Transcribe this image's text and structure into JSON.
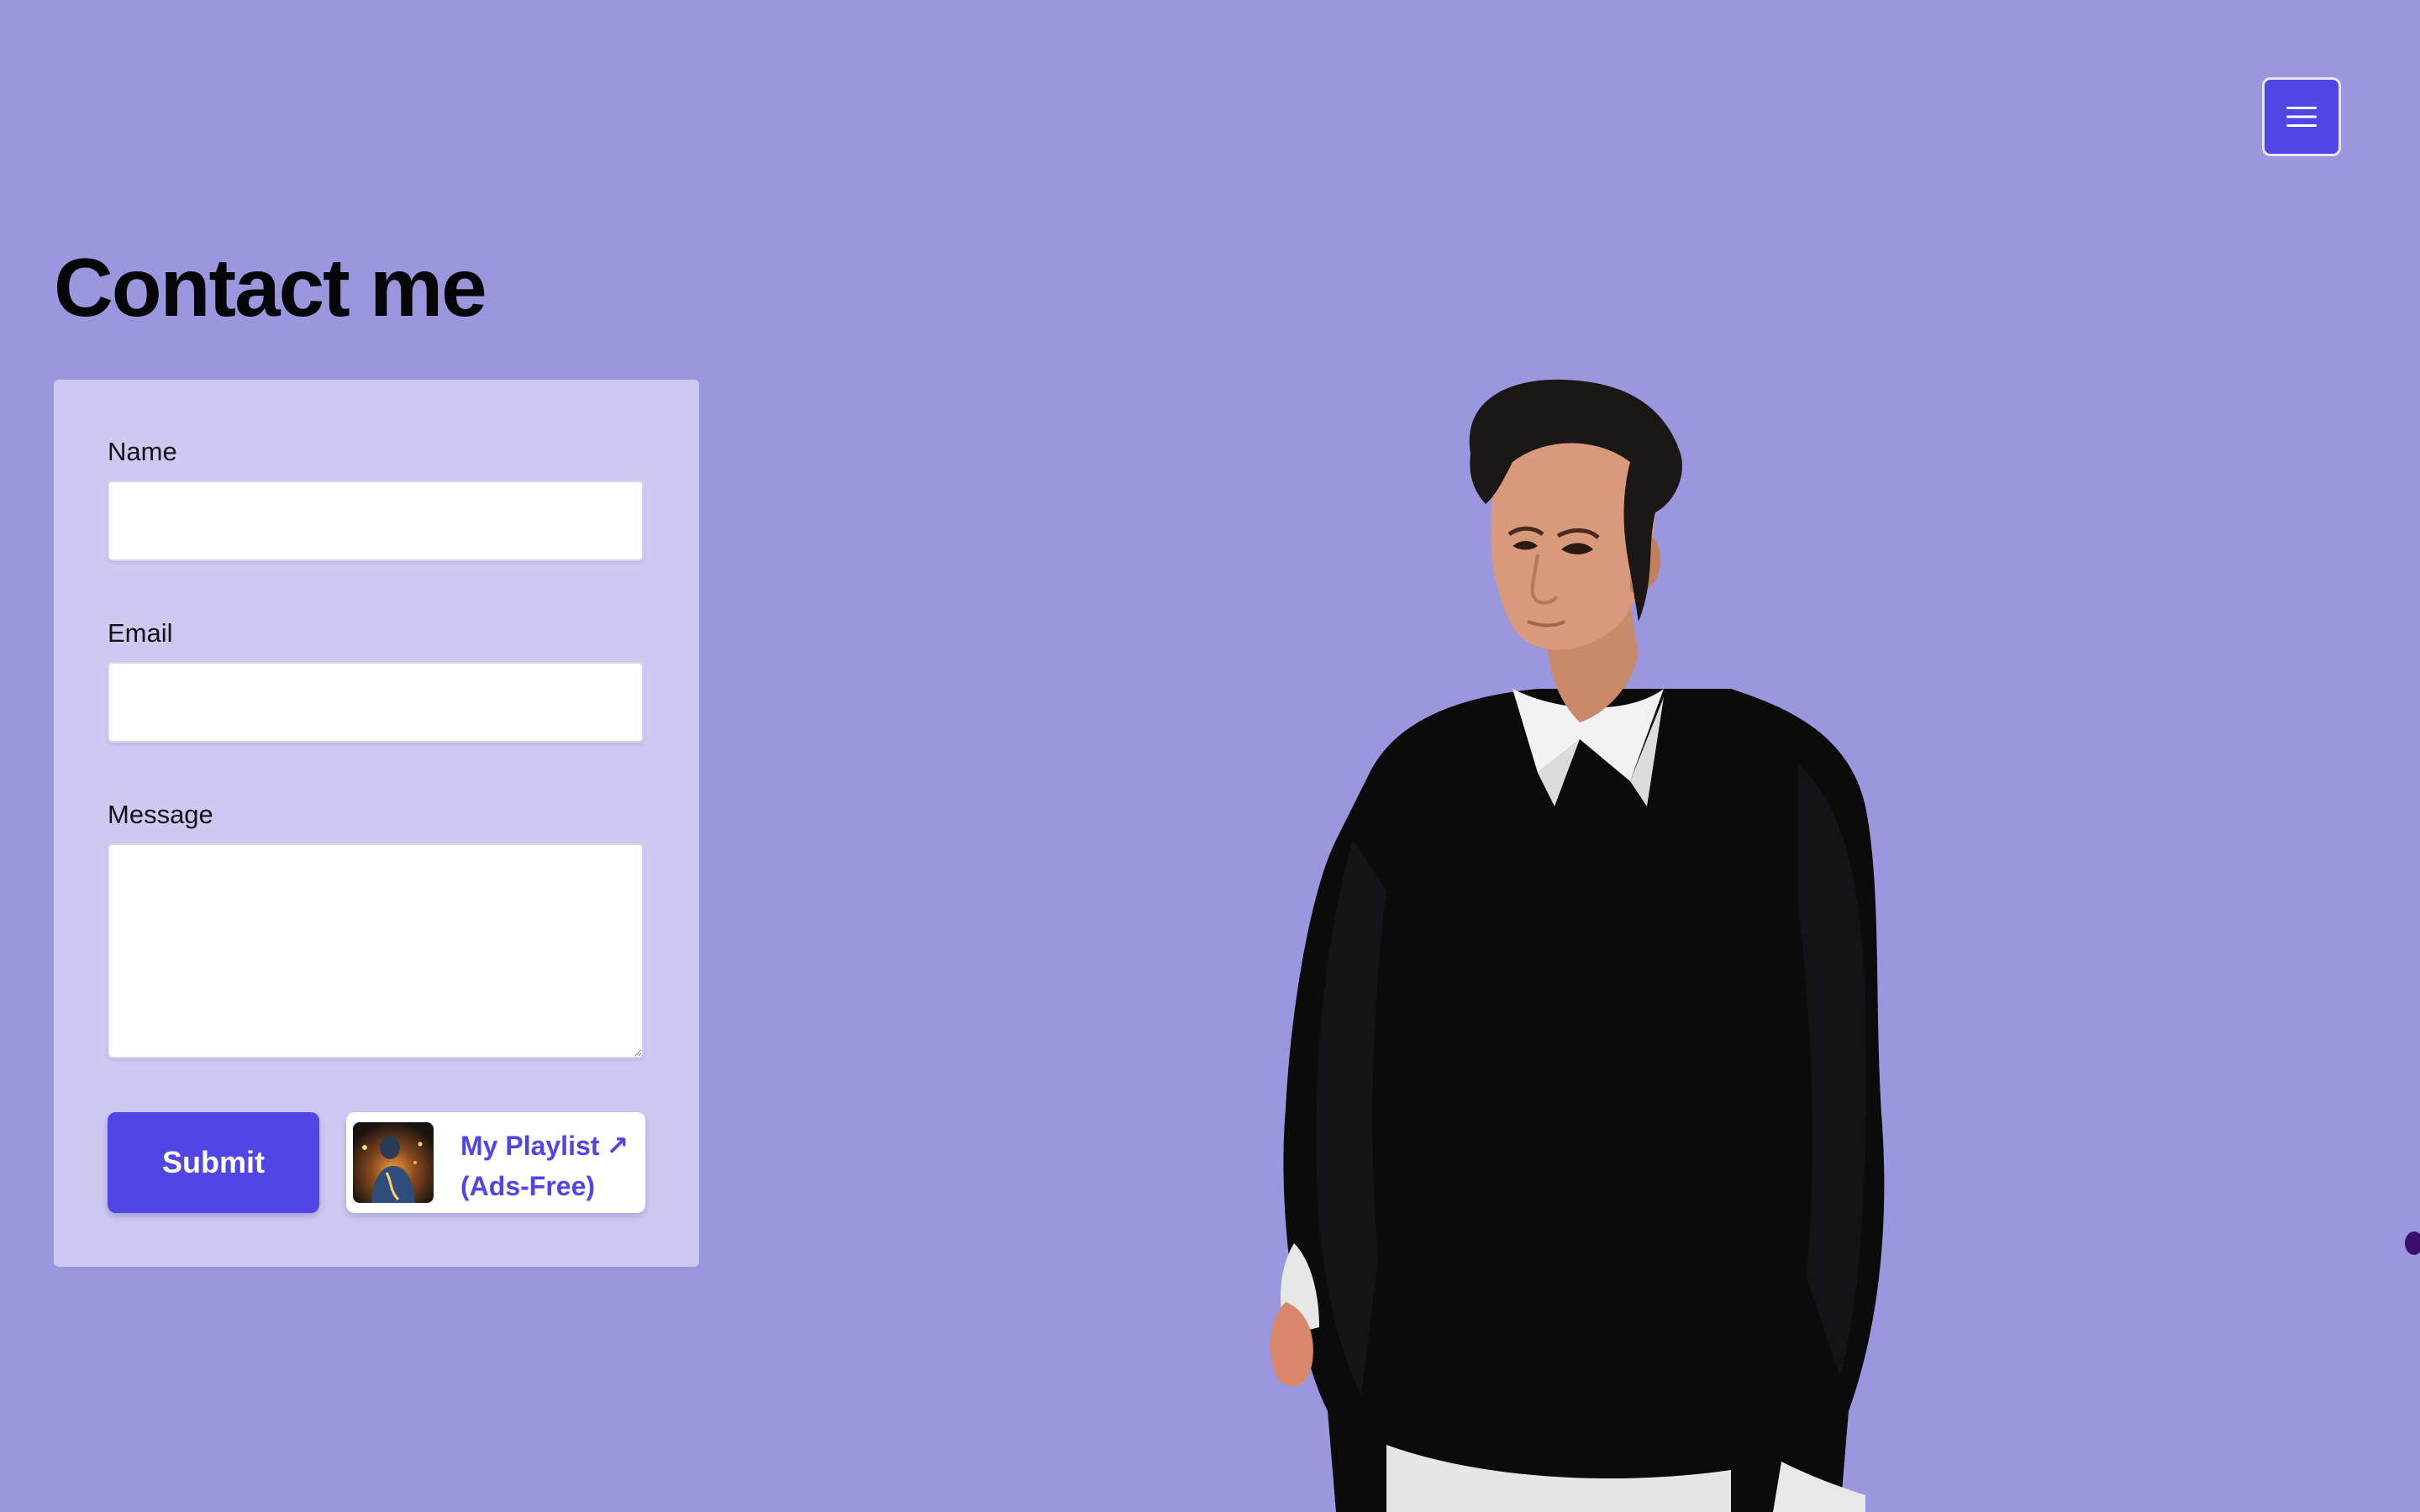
{
  "nav": {
    "menu_icon": "hamburger-menu-icon"
  },
  "page": {
    "title": "Contact me"
  },
  "form": {
    "name_label": "Name",
    "name_value": "",
    "email_label": "Email",
    "email_value": "",
    "message_label": "Message",
    "message_value": "",
    "submit_label": "Submit"
  },
  "playlist": {
    "line1": "My Playlist",
    "arrow": "↗",
    "line2": "(Ads-Free)"
  },
  "colors": {
    "background": "#9b97df",
    "card": "#cdcaf2",
    "accent": "#4f46e5"
  }
}
